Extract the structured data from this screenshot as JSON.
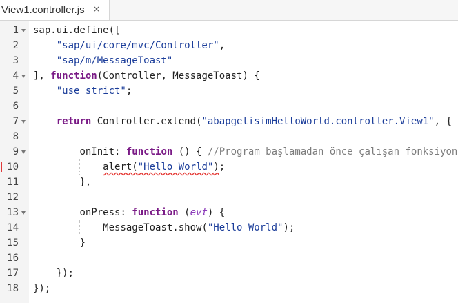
{
  "tab": {
    "title": "View1.controller.js",
    "close_glyph": "×"
  },
  "lines": {
    "l1": {
      "num": "1",
      "t1": "sap.ui.define(["
    },
    "l2": {
      "num": "2",
      "s1": "\"sap/ui/core/mvc/Controller\"",
      "t1": ","
    },
    "l3": {
      "num": "3",
      "s1": "\"sap/m/MessageToast\""
    },
    "l4": {
      "num": "4",
      "t1": "], ",
      "k1": "function",
      "t2": "(Controller, MessageToast) {"
    },
    "l5": {
      "num": "5",
      "s1": "\"use strict\"",
      "t1": ";"
    },
    "l6": {
      "num": "6"
    },
    "l7": {
      "num": "7",
      "k1": "return",
      "t1": " Controller.extend(",
      "s1": "\"abapgelisimHelloWorld.controller.View1\"",
      "t2": ", {"
    },
    "l8": {
      "num": "8"
    },
    "l9": {
      "num": "9",
      "t1": "onInit: ",
      "k1": "function",
      "t2": " () { ",
      "c1": "//Program başlamadan önce çalışan fonksiyon"
    },
    "l10": {
      "num": "10",
      "e1": "alert(",
      "s1": "\"Hello World\"",
      "e2": ")",
      "t1": ";"
    },
    "l11": {
      "num": "11",
      "t1": "},"
    },
    "l12": {
      "num": "12"
    },
    "l13": {
      "num": "13",
      "t1": "onPress: ",
      "k1": "function",
      "t2": " (",
      "p1": "evt",
      "t3": ") {"
    },
    "l14": {
      "num": "14",
      "t1": "MessageToast.show(",
      "s1": "\"Hello World\"",
      "t2": ");"
    },
    "l15": {
      "num": "15",
      "t1": "}"
    },
    "l16": {
      "num": "16"
    },
    "l17": {
      "num": "17",
      "t1": "});"
    },
    "l18": {
      "num": "18",
      "t1": "});"
    }
  },
  "colors": {
    "keyword": "#7a1a86",
    "string": "#1b3d9a",
    "comment": "#7d7d7d",
    "parameter": "#8a3ab9",
    "error_marker": "#e03a3a",
    "gutter_bg": "#f4f4f4"
  }
}
